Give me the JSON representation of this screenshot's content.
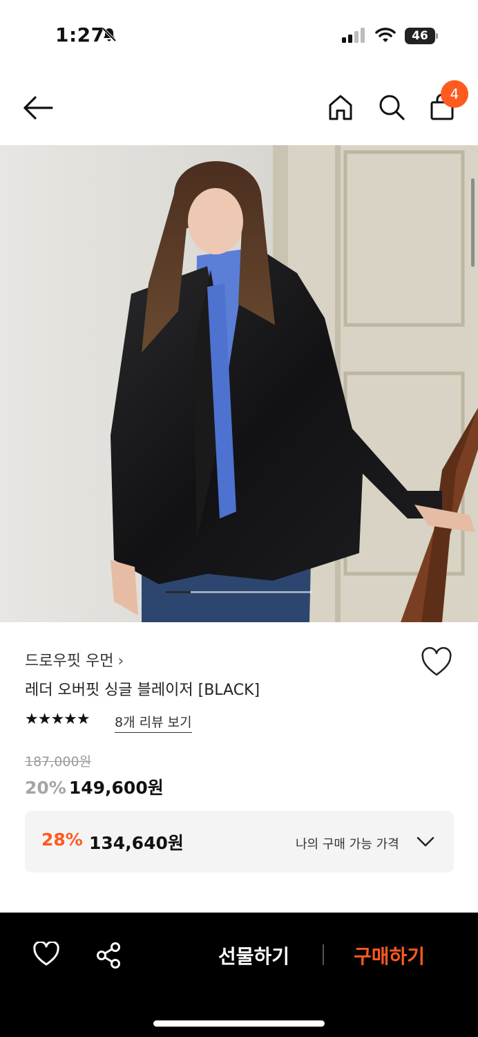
{
  "status_bar": {
    "time": "1:27",
    "battery": "46"
  },
  "header": {
    "cart_count": "4"
  },
  "product": {
    "brand": "드로우핏 우먼",
    "brand_chevron": "›",
    "title": "레더 오버핏 싱글 블레이저 [BLACK]",
    "stars": "★★★★★",
    "rating": 5,
    "review_link": "8개 리뷰 보기",
    "original_price": "187,000원",
    "discount_rate": "20%",
    "sale_price": "149,600원"
  },
  "best_price": {
    "rate": "28%",
    "price": "134,640원",
    "label": "나의 구매 가능 가격"
  },
  "bottom_bar": {
    "gift_label": "선물하기",
    "buy_label": "구매하기"
  },
  "colors": {
    "accent": "#ff5a1f",
    "bottom_bar_bg": "#000000"
  }
}
